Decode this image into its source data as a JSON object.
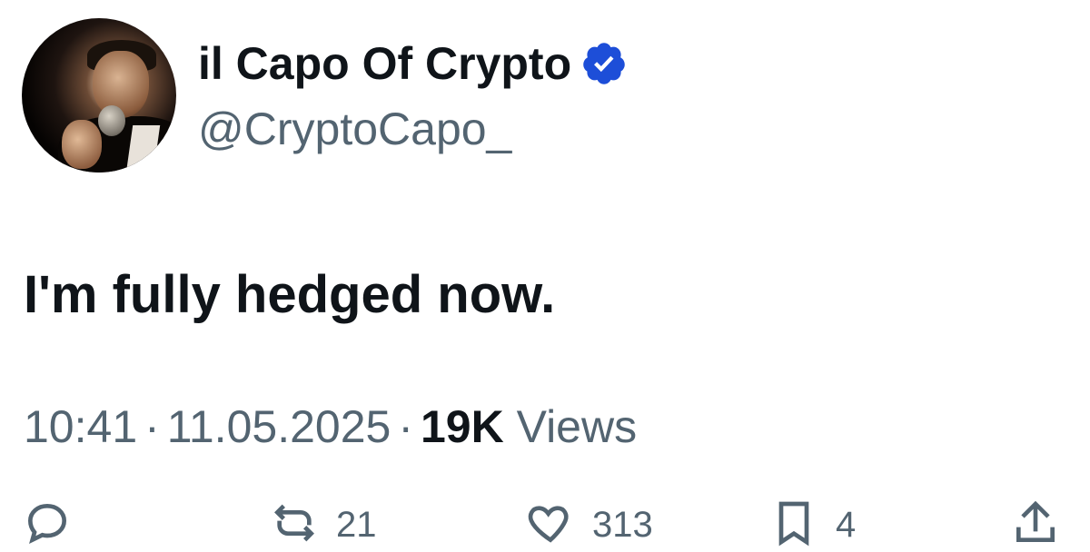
{
  "author": {
    "display_name": "il Capo Of Crypto",
    "handle": "@CryptoCapo_",
    "verified_icon": "verified-badge-icon",
    "badge_color": "#1d4ed8"
  },
  "tweet": {
    "text": "I'm fully hedged now."
  },
  "meta": {
    "time": "10:41",
    "date": "11.05.2025",
    "views_count": "19K",
    "views_label": "Views",
    "separator": "·"
  },
  "actions": {
    "reply": {
      "icon": "reply-icon"
    },
    "retweet": {
      "icon": "retweet-icon",
      "count": "21"
    },
    "like": {
      "icon": "heart-icon",
      "count": "313"
    },
    "bookmark": {
      "icon": "bookmark-icon",
      "count": "4"
    },
    "share": {
      "icon": "share-icon"
    }
  },
  "colors": {
    "text_primary": "#0f1419",
    "text_secondary": "#536471"
  }
}
